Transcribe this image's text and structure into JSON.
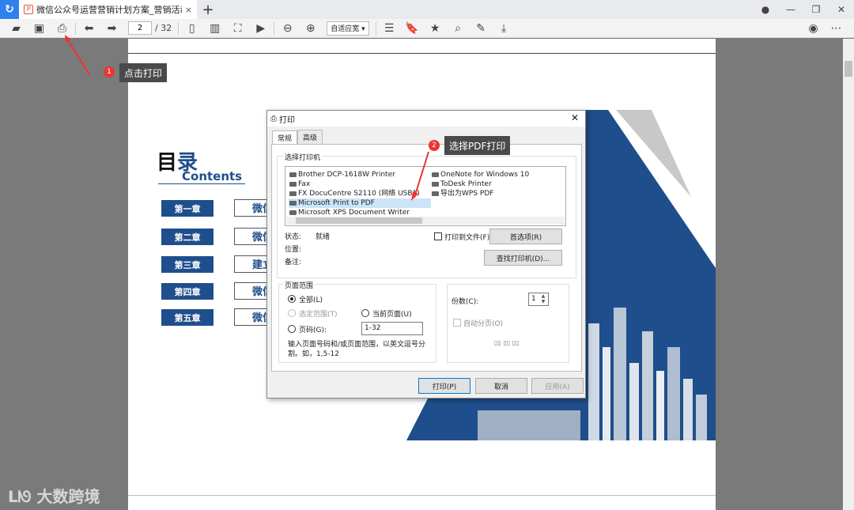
{
  "tab": {
    "title": "微信公众号运营营销计划方案_营销活动策...",
    "close": "×",
    "new": "+"
  },
  "toolbar": {
    "page_value": "2",
    "page_total": "/ 32",
    "zoom": "自适应宽 ▾"
  },
  "callout1": {
    "num": "1",
    "text": "点击打印"
  },
  "callout2": {
    "num": "2",
    "text": "选择PDF打印"
  },
  "doc": {
    "mulu_a": "目",
    "mulu_b": "录",
    "contents": "Contents",
    "chapters": [
      {
        "label": "第一章",
        "title": "微信"
      },
      {
        "label": "第二章",
        "title": "微信"
      },
      {
        "label": "第三章",
        "title": "建立"
      },
      {
        "label": "第四章",
        "title": "微信"
      },
      {
        "label": "第五章",
        "title": "微信"
      }
    ]
  },
  "dialog": {
    "title": "打印",
    "close": "✕",
    "tabs": [
      "常规",
      "高级"
    ],
    "printer_group": "选择打印机",
    "printers_left": [
      "Brother DCP-1618W Printer",
      "Fax",
      "FX DocuCentre S2110 (网络 USB1)",
      "Microsoft Print to PDF",
      "Microsoft XPS Document Writer"
    ],
    "printers_right": [
      "OneNote for Windows 10",
      "ToDesk Printer",
      "导出为WPS PDF"
    ],
    "status_label": "状态:",
    "status_value": "就绪",
    "location_label": "位置:",
    "comment_label": "备注:",
    "print_to_file": "打印到文件(F)",
    "prefs_button": "首选项(R)",
    "find_button": "查找打印机(D)...",
    "range_group": "页面范围",
    "all": "全部(L)",
    "selection": "选定范围(T)",
    "current": "当前页面(U)",
    "pages": "页码(G):",
    "pages_value": "1-32",
    "hint": "输入页面号码和/或页面范围，以英文逗号分割。如，1,5-12",
    "copies_label": "份数(C):",
    "copies_value": "1",
    "collate": "自动分页(O)",
    "print_button": "打印(P)",
    "cancel_button": "取消",
    "apply_button": "应用(A)"
  },
  "watermark": "大数跨境"
}
